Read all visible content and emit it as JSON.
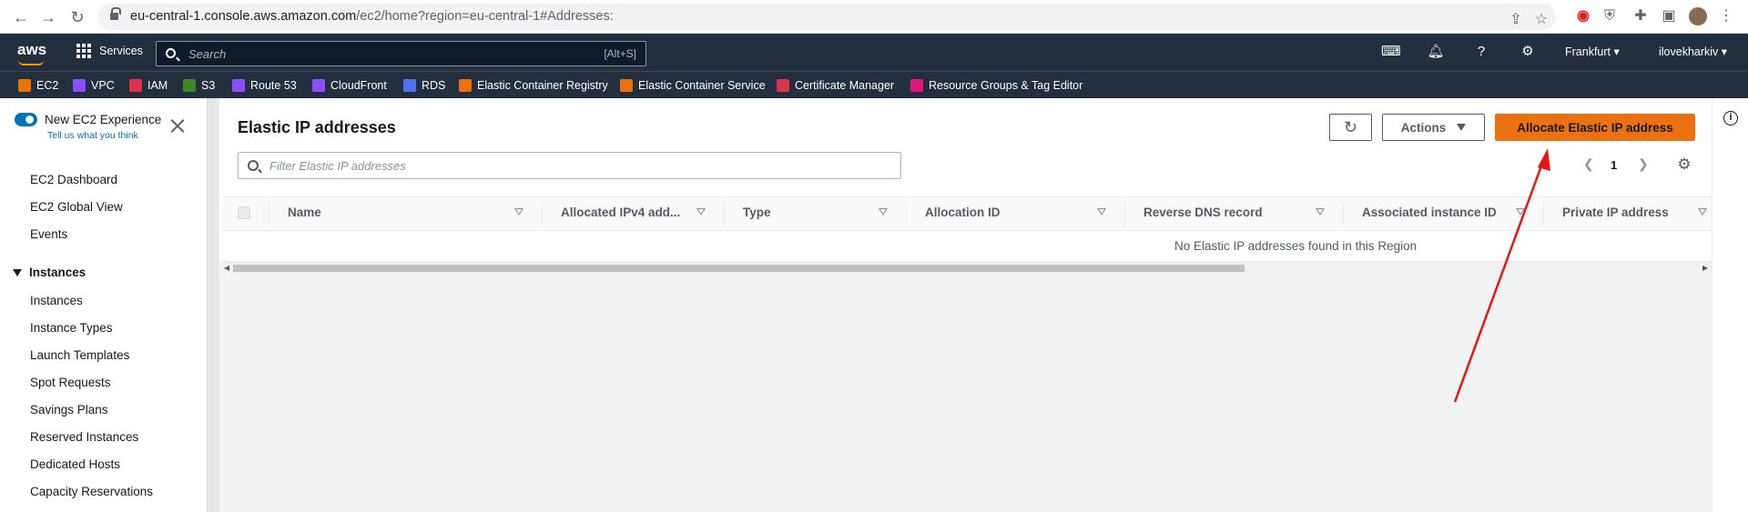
{
  "browser": {
    "url_host": "eu-central-1.console.aws.amazon.com",
    "url_path": "/ec2/home?region=eu-central-1#Addresses:",
    "icons": [
      "back-icon",
      "forward-icon",
      "reload-icon",
      "share-icon",
      "star-icon",
      "extension-icon",
      "puzzle-icon",
      "sidepanel-icon",
      "profile-avatar"
    ]
  },
  "topnav": {
    "logo": "aws",
    "services_label": "Services",
    "search_placeholder": "Search",
    "search_shortcut": "[Alt+S]",
    "region": "Frankfurt",
    "user": "ilovekharkiv"
  },
  "favorites": [
    {
      "label": "EC2",
      "color": "#ed7100"
    },
    {
      "label": "VPC",
      "color": "#8c4fff"
    },
    {
      "label": "IAM",
      "color": "#dd344c"
    },
    {
      "label": "S3",
      "color": "#3f8624"
    },
    {
      "label": "Route 53",
      "color": "#8c4fff"
    },
    {
      "label": "CloudFront",
      "color": "#8c4fff"
    },
    {
      "label": "RDS",
      "color": "#4d72f3"
    },
    {
      "label": "Elastic Container Registry",
      "color": "#ed7100"
    },
    {
      "label": "Elastic Container Service",
      "color": "#ed7100"
    },
    {
      "label": "Certificate Manager",
      "color": "#dd344c"
    },
    {
      "label": "Resource Groups & Tag Editor",
      "color": "#e7157b"
    }
  ],
  "sidebar": {
    "new_experience": "New EC2 Experience",
    "tell_us": "Tell us what you think",
    "items": [
      "EC2 Dashboard",
      "EC2 Global View",
      "Events"
    ],
    "section_title": "Instances",
    "section_items": [
      "Instances",
      "Instance Types",
      "Launch Templates",
      "Spot Requests",
      "Savings Plans",
      "Reserved Instances",
      "Dedicated Hosts",
      "Capacity Reservations"
    ]
  },
  "main": {
    "title": "Elastic IP addresses",
    "actions_label": "Actions",
    "allocate_label": "Allocate Elastic IP address",
    "filter_placeholder": "Filter Elastic IP addresses",
    "page_number": "1",
    "columns": [
      "Name",
      "Allocated IPv4 add...",
      "Type",
      "Allocation ID",
      "Reverse DNS record",
      "Associated instance ID",
      "Private IP address"
    ],
    "empty_message": "No Elastic IP addresses found in this Region"
  },
  "colors": {
    "aws_nav": "#232f3e",
    "primary_button": "#ec7211",
    "annotation_arrow": "#e8160c"
  }
}
